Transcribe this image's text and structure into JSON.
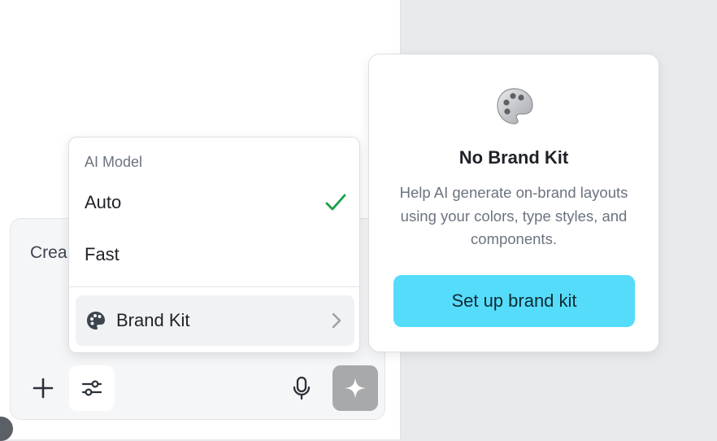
{
  "prompt": {
    "text": "Crea"
  },
  "toolbar": {
    "add_icon": "plus-icon",
    "settings_icon": "sliders-icon",
    "mic_icon": "microphone-icon",
    "generate_icon": "sparkle-icon"
  },
  "model_menu": {
    "header": "AI Model",
    "options": [
      {
        "label": "Auto",
        "selected": true
      },
      {
        "label": "Fast",
        "selected": false
      }
    ],
    "brand_kit_label": "Brand Kit"
  },
  "brand_card": {
    "title": "No Brand Kit",
    "description": "Help AI generate on-brand layouts using your colors, type styles, and components.",
    "button_label": "Set up brand kit"
  },
  "colors": {
    "accent": "#56dcfb",
    "check": "#1a9e4b",
    "generate_button": "#a7a9ab"
  }
}
